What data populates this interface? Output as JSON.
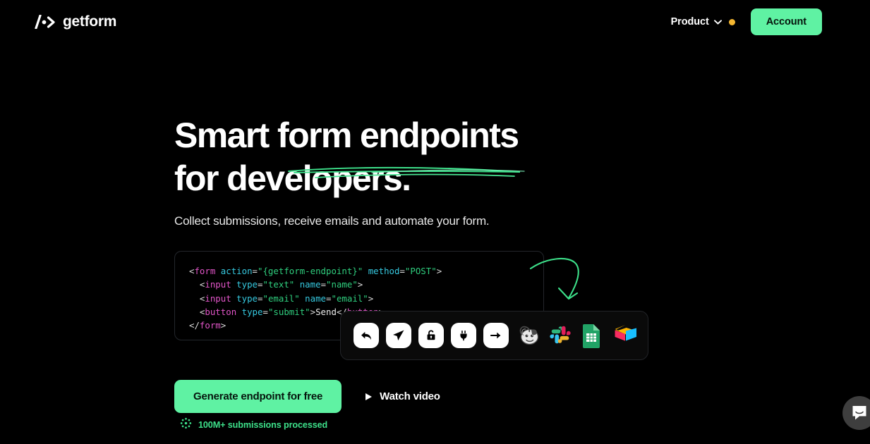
{
  "header": {
    "logo_icon": "slash-dot-arrow-icon",
    "logo_text": "getform",
    "nav": {
      "product_label": "Product",
      "product_chevron_icon": "chevron-down-icon",
      "product_dot_color": "#F5B731"
    },
    "account_label": "Account",
    "account_color": "#5FF2A3"
  },
  "hero": {
    "headline_line1": "Smart form endpoints",
    "headline_line2": "for developers.",
    "underline_color": "#3DE08A",
    "subtitle": "Collect submissions, receive emails and automate your form."
  },
  "code": {
    "line1": {
      "p1": "<",
      "tag1": "form",
      "sp1": " ",
      "attr1": "action",
      "eq1": "=",
      "str1": "\"{getform-endpoint}\"",
      "sp2": " ",
      "attr2": "method",
      "eq2": "=",
      "str2": "\"POST\"",
      "p2": ">"
    },
    "line2": {
      "indent": "  ",
      "p1": "<",
      "tag1": "input",
      "sp1": " ",
      "attr1": "type",
      "eq1": "=",
      "str1": "\"text\"",
      "sp2": " ",
      "attr2": "name",
      "eq2": "=",
      "str2": "\"name\"",
      "p2": ">"
    },
    "line3": {
      "indent": "  ",
      "p1": "<",
      "tag1": "input",
      "sp1": " ",
      "attr1": "type",
      "eq1": "=",
      "str1": "\"email\"",
      "sp2": " ",
      "attr2": "name",
      "eq2": "=",
      "str2": "\"email\"",
      "p2": ">"
    },
    "line4": {
      "indent": "  ",
      "p1": "<",
      "tag1": "button",
      "sp1": " ",
      "attr1": "type",
      "eq1": "=",
      "str1": "\"submit\"",
      "p2": ">",
      "text": "Send",
      "p3": "</",
      "tag2": "button",
      "p4": ">"
    },
    "line5": {
      "p1": "</",
      "tag1": "form",
      "p2": ">"
    }
  },
  "annotation": {
    "arrow_icon": "hand-drawn-curved-arrow-icon",
    "arrow_color": "#3DE08A"
  },
  "integrations": {
    "items": [
      {
        "name": "autoresponder-reply-icon",
        "label": "Autoresponder"
      },
      {
        "name": "send-telegram-icon",
        "label": "Telegram"
      },
      {
        "name": "spam-lock-icon",
        "label": "Spam protection"
      },
      {
        "name": "webhook-plug-icon",
        "label": "Webhooks"
      },
      {
        "name": "forward-arrow-icon",
        "label": "Forward"
      },
      {
        "name": "mailchimp-icon",
        "label": "Mailchimp"
      },
      {
        "name": "slack-icon",
        "label": "Slack"
      },
      {
        "name": "google-sheets-icon",
        "label": "Google Sheets"
      },
      {
        "name": "airtable-icon",
        "label": "Airtable"
      }
    ]
  },
  "cta": {
    "primary_label": "Generate endpoint for free",
    "video_label": "Watch video",
    "video_icon": "play-icon"
  },
  "stats": {
    "icon": "spinner-dots-icon",
    "label": "100M+ submissions processed",
    "color": "#3DE08A"
  },
  "support": {
    "widget_icon": "intercom-chat-icon"
  }
}
